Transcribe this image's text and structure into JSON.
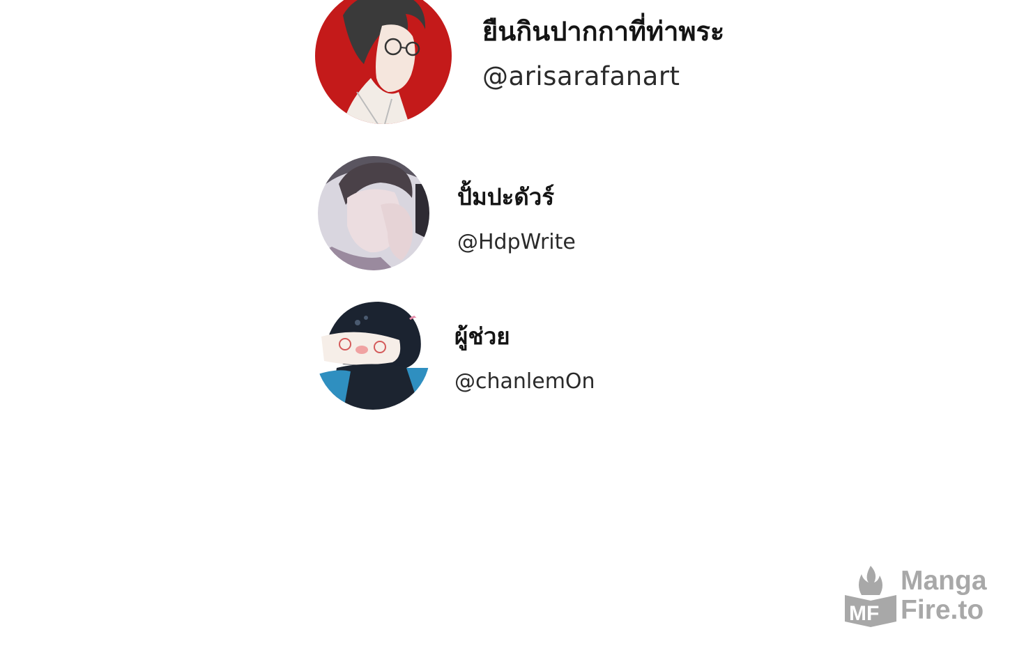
{
  "credits": [
    {
      "name": "ยืนกินปากกาที่ท่าพระ",
      "handle": "@arisarafanart",
      "avatar_icon": "man-with-glasses-avatar"
    },
    {
      "name": "ปั้มปะดัวร์",
      "handle": "@HdpWrite",
      "avatar_icon": "man-hand-on-face-avatar"
    },
    {
      "name": "ผู้ช่วย",
      "handle": "@chanlemOn",
      "avatar_icon": "cartoon-girl-avatar"
    }
  ],
  "watermark": {
    "line1": "Manga",
    "line2": "Fire.to",
    "logo_text": "MF",
    "color": "#a8a8a8"
  }
}
